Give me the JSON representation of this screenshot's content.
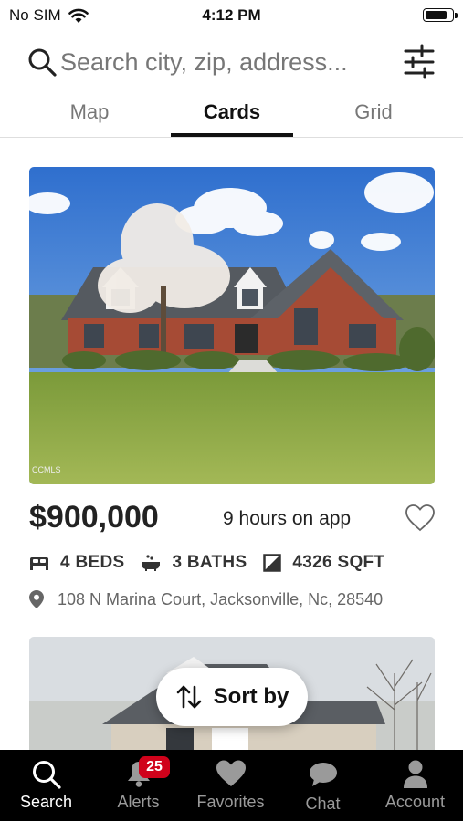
{
  "status": {
    "carrier": "No SIM",
    "time": "4:12 PM",
    "battery_level": 0.85
  },
  "search": {
    "placeholder": "Search city, zip, address..."
  },
  "tabs": [
    {
      "label": "Map",
      "active": false
    },
    {
      "label": "Cards",
      "active": true
    },
    {
      "label": "Grid",
      "active": false
    }
  ],
  "listing": {
    "price": "$900,000",
    "time_on_app": "9 hours on app",
    "beds": "4 BEDS",
    "baths": "3 BATHS",
    "sqft": "4326 SQFT",
    "address": "108 N Marina Court, Jacksonville, Nc, 28540",
    "photo_watermark": "CCMLS"
  },
  "sort": {
    "label": "Sort by"
  },
  "nav": {
    "items": [
      {
        "label": "Search",
        "icon": "search-icon",
        "active": true
      },
      {
        "label": "Alerts",
        "icon": "bell-icon",
        "active": false
      },
      {
        "label": "Favorites",
        "icon": "heart-icon",
        "active": false
      },
      {
        "label": "Chat",
        "icon": "chat-icon",
        "active": false
      },
      {
        "label": "Account",
        "icon": "person-icon",
        "active": false
      }
    ],
    "alerts_badge": "25"
  },
  "colors": {
    "badge": "#d0021b",
    "nav_background": "#000000",
    "active_tab": "#111111"
  }
}
